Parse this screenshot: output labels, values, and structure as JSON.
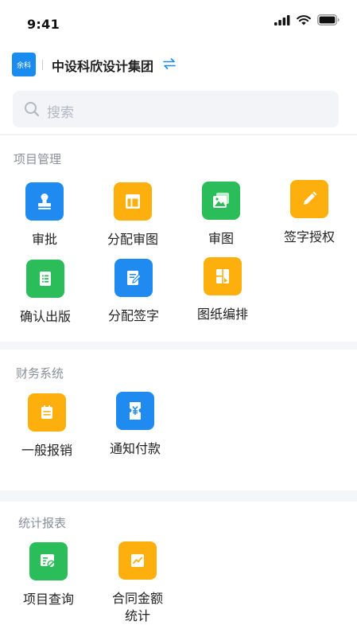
{
  "status_bar": {
    "time": "9:41"
  },
  "header": {
    "logo_text": "余科",
    "company_name": "中设科欣设计集团"
  },
  "search": {
    "placeholder": "搜索"
  },
  "sections": [
    {
      "title": "项目管理",
      "items": [
        {
          "label": "审批",
          "icon": "stamp-icon",
          "color": "#1f8af0"
        },
        {
          "label": "分配审图",
          "icon": "layout-icon",
          "color": "#fdb00d"
        },
        {
          "label": "审图",
          "icon": "image-icon",
          "color": "#2bbd5a"
        },
        {
          "label": "签字授权",
          "icon": "pencil-icon",
          "color": "#fdb00d"
        },
        {
          "label": "确认出版",
          "icon": "list-icon",
          "color": "#2bbd5a"
        },
        {
          "label": "分配签字",
          "icon": "edit-document-icon",
          "color": "#1f8af0"
        },
        {
          "label": "图纸编排",
          "icon": "drawing-layout-icon",
          "color": "#fdb00d"
        }
      ]
    },
    {
      "title": "财务系统",
      "items": [
        {
          "label": "一般报销",
          "icon": "calendar-icon",
          "color": "#fdb00d"
        },
        {
          "label": "通知付款",
          "icon": "yuan-ticket-icon",
          "color": "#1f8af0"
        }
      ]
    },
    {
      "title": "统计报表",
      "items": [
        {
          "label": "项目查询",
          "icon": "report-search-icon",
          "color": "#2bbd5a"
        },
        {
          "label": "合同金额\n统计",
          "icon": "trend-chart-icon",
          "color": "#fdb00d"
        }
      ]
    }
  ]
}
